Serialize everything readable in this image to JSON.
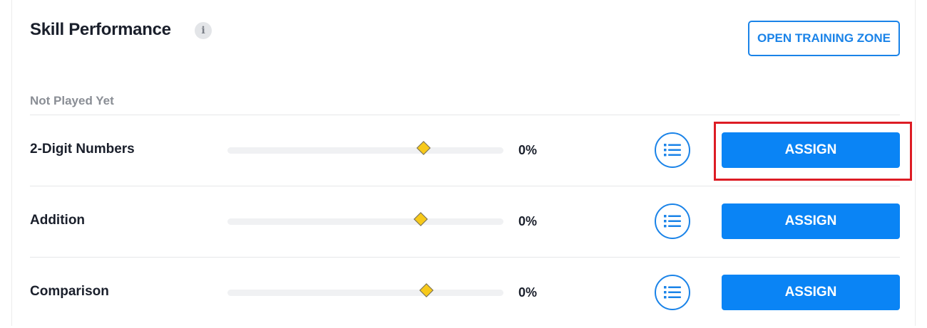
{
  "header": {
    "title": "Skill Performance",
    "info_icon": "i",
    "open_training_zone_label": "OPEN TRAINING ZONE"
  },
  "section": {
    "label": "Not Played Yet"
  },
  "skills": [
    {
      "name": "2-Digit Numbers",
      "percent_label": "0%",
      "marker_position": 0.71,
      "assign_label": "ASSIGN",
      "list_icon": "list-icon"
    },
    {
      "name": "Addition",
      "percent_label": "0%",
      "marker_position": 0.7,
      "assign_label": "ASSIGN",
      "list_icon": "list-icon"
    },
    {
      "name": "Comparison",
      "percent_label": "0%",
      "marker_position": 0.72,
      "assign_label": "ASSIGN",
      "list_icon": "list-icon"
    }
  ],
  "colors": {
    "accent": "#0a84f5",
    "outline_accent": "#1a83e8",
    "marker": "#f7c91a",
    "highlight": "#dd1c24",
    "title_text": "#1a1f2b",
    "muted_text": "#8a8e95"
  }
}
